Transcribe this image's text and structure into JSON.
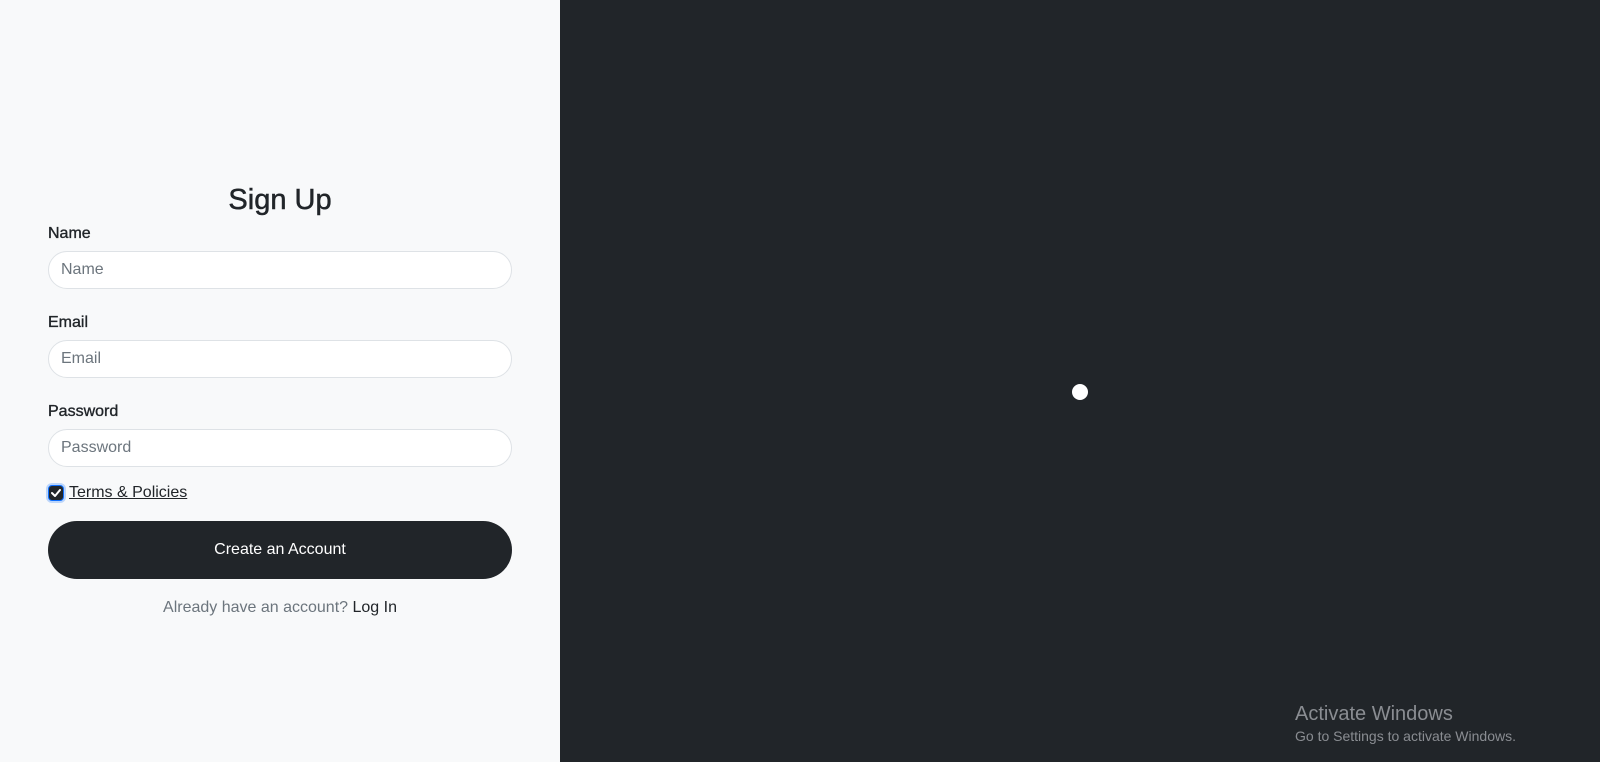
{
  "form": {
    "title": "Sign Up",
    "name_label": "Name",
    "name_placeholder": "Name",
    "name_value": "",
    "email_label": "Email",
    "email_placeholder": "Email",
    "email_value": "",
    "password_label": "Password",
    "password_placeholder": "Password",
    "password_value": "",
    "terms_checked": true,
    "terms_label": "Terms & Policies",
    "submit_label": "Create an Account",
    "login_prompt": "Already have an account?",
    "login_link": "Log In"
  },
  "windows_watermark": {
    "title": "Activate Windows",
    "subtitle": "Go to Settings to activate Windows."
  },
  "colors": {
    "left_background": "#f8f9fa",
    "right_background": "#212529",
    "button_background": "#212529",
    "loader_dot": "#ffffff"
  },
  "icons": {
    "checkbox": "check-icon",
    "loader": "loading-dot"
  }
}
